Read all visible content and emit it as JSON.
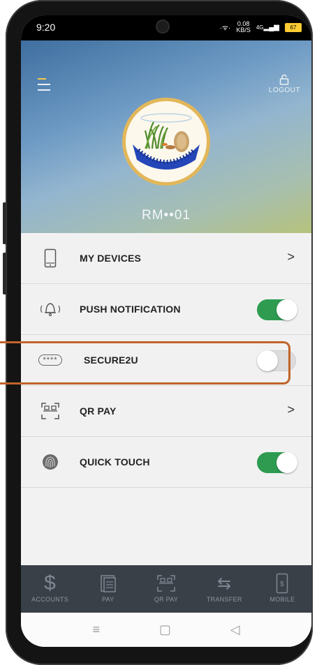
{
  "status": {
    "time": "9:20",
    "data_rate": "0.08",
    "data_unit": "KB/S",
    "network": "4G",
    "battery": "67"
  },
  "header": {
    "logout_label": "LOGOUT",
    "username": "RM••01"
  },
  "settings": [
    {
      "label": "MY DEVICES",
      "icon": "phone-icon",
      "control": "chevron",
      "chevron": ">"
    },
    {
      "label": "PUSH NOTIFICATION",
      "icon": "bell-icon",
      "control": "toggle",
      "on": true
    },
    {
      "label": "SECURE2U",
      "icon": "password-icon",
      "icon_text": "****",
      "control": "toggle",
      "on": false,
      "highlighted": true
    },
    {
      "label": "QR PAY",
      "icon": "qr-code-icon",
      "control": "chevron",
      "chevron": ">"
    },
    {
      "label": "QUICK TOUCH",
      "icon": "fingerprint-icon",
      "control": "toggle",
      "on": true
    }
  ],
  "bottom_nav": [
    {
      "label": "ACCOUNTS",
      "icon": "dollar-icon"
    },
    {
      "label": "PAY",
      "icon": "bill-icon"
    },
    {
      "label": "QR PAY",
      "icon": "qr-code-icon"
    },
    {
      "label": "TRANSFER",
      "icon": "transfer-arrows-icon"
    },
    {
      "label": "MOBILE",
      "icon": "mobile-reload-icon"
    }
  ],
  "colors": {
    "toggle_on": "#2e9b51",
    "highlight": "#c0642a",
    "nav_bg": "#3a4048",
    "menu_accent": "#f3c84a",
    "avatar_ring": "#e2b75a"
  }
}
